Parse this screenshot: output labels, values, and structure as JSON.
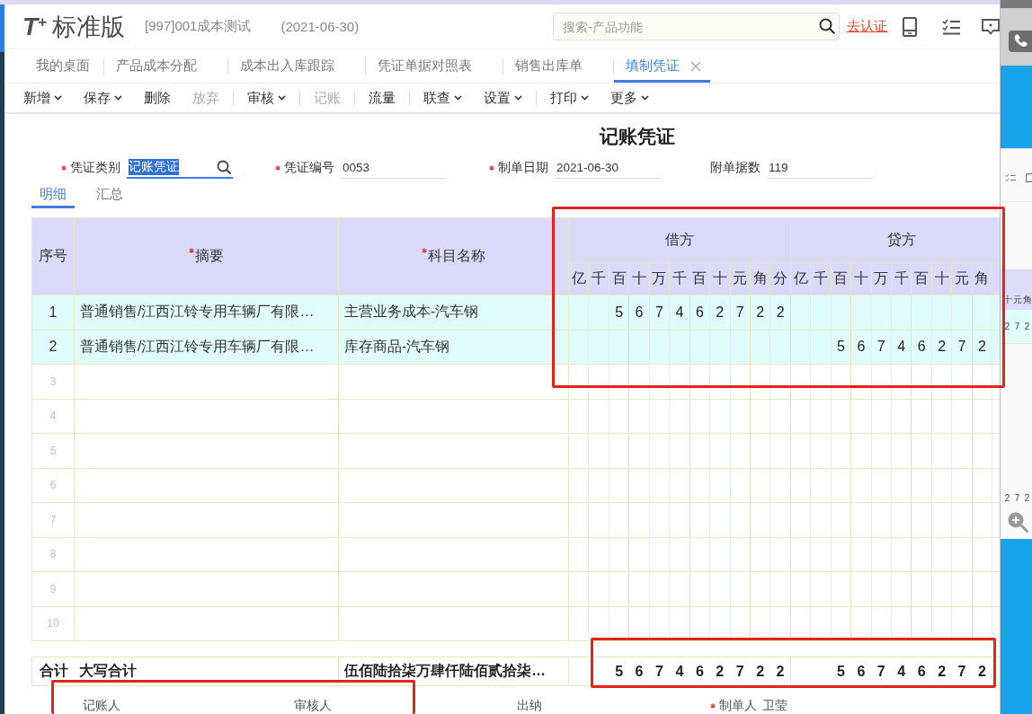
{
  "header": {
    "logo": "T$^{+}$",
    "edition": "标准版",
    "account": "[997]001成本测试",
    "date": "(2021-06-30)",
    "search": {
      "placeholder": "搜索-产品功能"
    },
    "certify_link": "去认证"
  },
  "tabs": [
    {
      "label": "我的桌面",
      "selected": false,
      "closable": false
    },
    {
      "label": "产品成本分配",
      "selected": false,
      "closable": false
    },
    {
      "label": "成本出入库跟踪",
      "selected": false,
      "closable": false
    },
    {
      "label": "凭证单据对照表",
      "selected": false,
      "closable": false
    },
    {
      "label": "销售出库单",
      "selected": false,
      "closable": false
    },
    {
      "label": "填制凭证",
      "selected": true,
      "closable": true
    }
  ],
  "toolbar": [
    {
      "kind": "button",
      "label": "新增",
      "menu": true,
      "disabled": false
    },
    {
      "kind": "button",
      "label": "保存",
      "menu": true,
      "disabled": false
    },
    {
      "kind": "button",
      "label": "删除",
      "menu": false,
      "disabled": false
    },
    {
      "kind": "button",
      "label": "放弃",
      "menu": false,
      "disabled": true
    },
    {
      "kind": "divider"
    },
    {
      "kind": "button",
      "label": "审核",
      "menu": true,
      "disabled": false
    },
    {
      "kind": "divider"
    },
    {
      "kind": "button",
      "label": "记账",
      "menu": false,
      "disabled": true
    },
    {
      "kind": "divider"
    },
    {
      "kind": "button",
      "label": "流量",
      "menu": false,
      "disabled": false
    },
    {
      "kind": "divider"
    },
    {
      "kind": "button",
      "label": "联查",
      "menu": true,
      "disabled": false
    },
    {
      "kind": "button",
      "label": "设置",
      "menu": true,
      "disabled": false
    },
    {
      "kind": "divider"
    },
    {
      "kind": "button",
      "label": "打印",
      "menu": true,
      "disabled": false
    },
    {
      "kind": "button",
      "label": "更多",
      "menu": true,
      "disabled": false
    }
  ],
  "voucher": {
    "title": "记账凭证",
    "fields": [
      {
        "label": "凭证类别",
        "required": true,
        "value": "记账凭证",
        "focused": true,
        "lookup": true
      },
      {
        "label": "凭证编号",
        "required": true,
        "value": "0053",
        "focused": false,
        "lookup": false
      },
      {
        "label": "制单日期",
        "required": true,
        "value": "2021-06-30",
        "focused": false,
        "lookup": false
      },
      {
        "label": "附单据数",
        "required": false,
        "value": "119",
        "focused": false,
        "lookup": false
      }
    ],
    "subtabs": [
      {
        "label": "明细",
        "selected": true
      },
      {
        "label": "汇总",
        "selected": false
      }
    ],
    "table": {
      "columns": [
        {
          "label": "序号",
          "required": false
        },
        {
          "label": "摘要",
          "required": true
        },
        {
          "label": "科目名称",
          "required": true
        }
      ],
      "debit": {
        "label": "借方",
        "units": [
          "亿",
          "千",
          "百",
          "十",
          "万",
          "千",
          "百",
          "十",
          "元",
          "角",
          "分"
        ]
      },
      "credit": {
        "label": "贷方",
        "units": [
          "亿",
          "千",
          "百",
          "十",
          "万",
          "千",
          "百",
          "十",
          "元",
          "角"
        ]
      },
      "rows": [
        {
          "no": "1",
          "summary": "普通销售/江西江铃专用车辆厂有限…",
          "account": "主营业务成本-汽车钢",
          "debit": "5 6 7 4 6 2 7 2 2"
        },
        {
          "no": "2",
          "summary": "普通销售/江西江铃专用车辆厂有限…",
          "account": "库存商品-汽车钢",
          "credit": "5 6 7 4 6 2 7 2"
        },
        {
          "no": "3"
        },
        {
          "no": "4"
        },
        {
          "no": "5"
        },
        {
          "no": "6"
        },
        {
          "no": "7"
        },
        {
          "no": "8"
        },
        {
          "no": "9"
        },
        {
          "no": "10"
        }
      ],
      "total": {
        "label": "合计",
        "words_label": "大写合计",
        "words": "伍佰陆拾柒万肆仟陆佰贰拾柒…",
        "debit": "5 6 7 4 6 2 7 2 2",
        "credit": "5 6 7 4 6 2 7 2"
      }
    },
    "signatures": [
      {
        "label": "记账人",
        "required": false
      },
      {
        "label": "审核人",
        "required": false
      },
      {
        "label": "出纳",
        "required": false
      },
      {
        "label": "制单人",
        "required": true,
        "value": "卫莹"
      }
    ]
  },
  "side_window": {
    "units": [
      "十",
      "元",
      "角"
    ],
    "amounts": [
      "2 7 2",
      "2 7 2"
    ]
  },
  "annotations": [
    {
      "kind": "frame"
    },
    {
      "kind": "frame"
    },
    {
      "kind": "frame"
    }
  ]
}
